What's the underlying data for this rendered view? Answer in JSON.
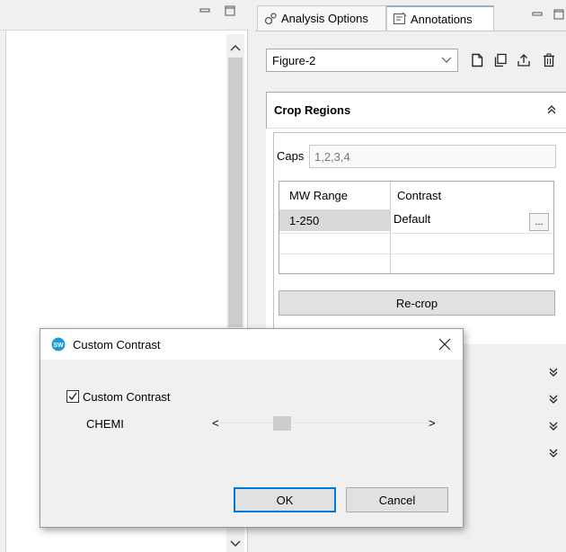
{
  "left_pane": {
    "minimize_glyph": "▭",
    "maximize_glyph": "▢",
    "scroll_up": "⌃",
    "scroll_down": "⌄"
  },
  "tabs": [
    {
      "label": "Analysis Options",
      "icon": "gear-cluster-icon"
    },
    {
      "label": "Annotations",
      "icon": "annotation-icon"
    }
  ],
  "figure_select": {
    "value": "Figure-2"
  },
  "crop_regions": {
    "title": "Crop Regions",
    "caps_label": "Caps",
    "caps_value": "1,2,3,4",
    "columns": [
      "MW Range",
      "Contrast"
    ],
    "rows": [
      {
        "mw_range": "1-250",
        "contrast": "Default",
        "action": "..."
      }
    ],
    "recrop_label": "Re-crop"
  },
  "dialog": {
    "title": "Custom Contrast",
    "checkbox_label": "Custom Contrast",
    "checked": true,
    "channel_label": "CHEMI",
    "slider_left": "<",
    "slider_right": ">",
    "ok_label": "OK",
    "cancel_label": "Cancel"
  },
  "colors": {
    "accent": "#0078d7",
    "app_icon": "#1a9ad6"
  }
}
